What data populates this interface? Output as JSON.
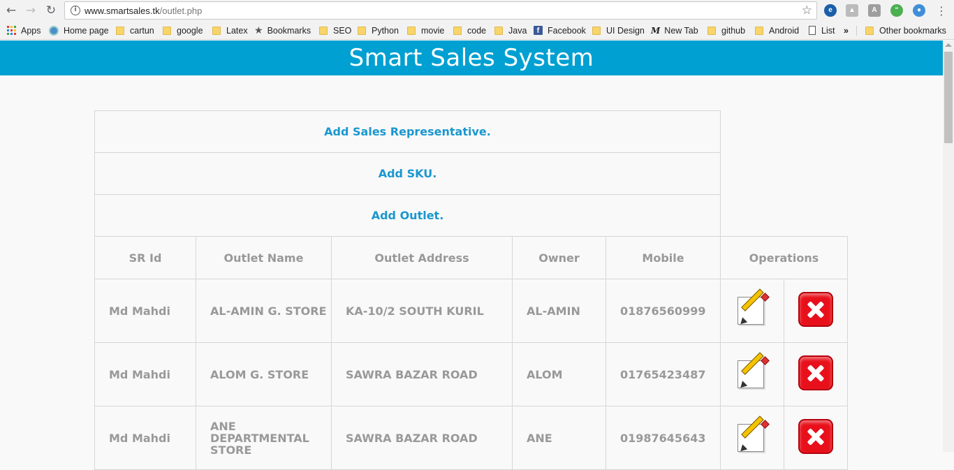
{
  "browser": {
    "url_host": "www.smartsales.tk",
    "url_path": "/outlet.php",
    "bookmarks": [
      {
        "label": "Apps",
        "icon": "apps-grid-icon"
      },
      {
        "label": "Home page",
        "icon": "globe-icon"
      },
      {
        "label": "cartun",
        "icon": "folder-icon"
      },
      {
        "label": "google",
        "icon": "folder-icon"
      },
      {
        "label": "Latex",
        "icon": "folder-icon"
      },
      {
        "label": "Bookmarks",
        "icon": "star-icon"
      },
      {
        "label": "SEO",
        "icon": "folder-icon"
      },
      {
        "label": "Python",
        "icon": "folder-icon"
      },
      {
        "label": "movie",
        "icon": "folder-icon"
      },
      {
        "label": "code",
        "icon": "folder-icon"
      },
      {
        "label": "Java",
        "icon": "folder-icon"
      },
      {
        "label": "Facebook",
        "icon": "facebook-icon"
      },
      {
        "label": "UI Design",
        "icon": "folder-icon"
      },
      {
        "label": "New Tab",
        "icon": "medium-icon"
      },
      {
        "label": "github",
        "icon": "folder-icon"
      },
      {
        "label": "Android",
        "icon": "folder-icon"
      },
      {
        "label": "List",
        "icon": "page-icon"
      }
    ],
    "more_chevron": "»",
    "other_bookmarks": "Other bookmarks"
  },
  "site": {
    "title": "Smart Sales System",
    "header_color": "#00a0d2",
    "link_color": "#1a97cf"
  },
  "actions": {
    "add_sr": "Add Sales Representative.",
    "add_sku": "Add SKU.",
    "add_outlet": "Add Outlet."
  },
  "table": {
    "headers": [
      "SR Id",
      "Outlet Name",
      "Outlet Address",
      "Owner",
      "Mobile",
      "Operations"
    ],
    "rows": [
      {
        "sr_id": "Md Mahdi",
        "outlet_name": "AL-AMIN G. STORE",
        "address": "KA-10/2 SOUTH KURIL",
        "owner": "AL-AMIN",
        "mobile": "01876560999"
      },
      {
        "sr_id": "Md Mahdi",
        "outlet_name": "ALOM G. STORE",
        "address": "SAWRA BAZAR ROAD",
        "owner": "ALOM",
        "mobile": "01765423487"
      },
      {
        "sr_id": "Md Mahdi",
        "outlet_name": "ANE DEPARTMENTAL STORE",
        "address": "SAWRA BAZAR ROAD",
        "owner": "ANE",
        "mobile": "01987645643"
      }
    ]
  }
}
